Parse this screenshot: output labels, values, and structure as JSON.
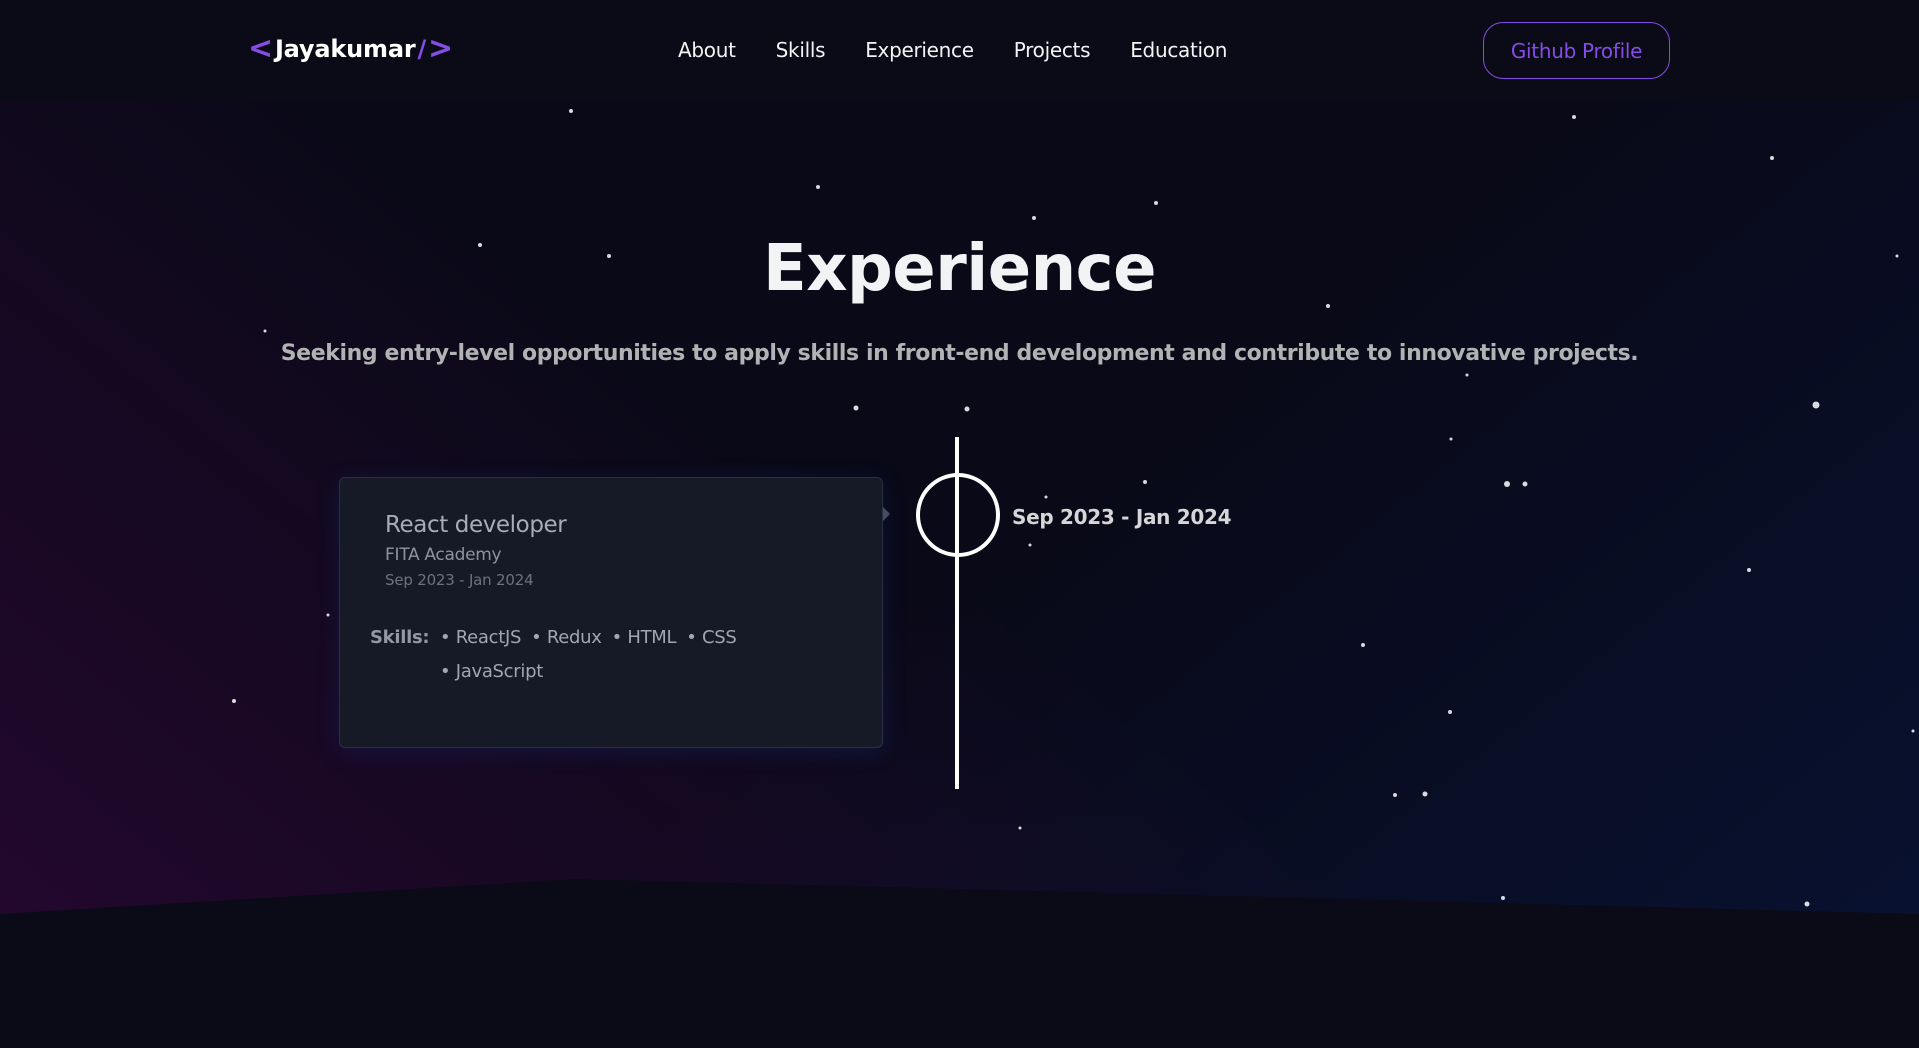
{
  "navbar": {
    "logo": {
      "left_chevron": "<",
      "name": "Jayakumar",
      "slash": "/",
      "right_chevron": ">"
    },
    "links": [
      "About",
      "Skills",
      "Experience",
      "Projects",
      "Education"
    ],
    "github_button": "Github Profile"
  },
  "section": {
    "title": "Experience",
    "subtitle": "Seeking entry-level opportunities to apply skills in front-end development and contribute to innovative projects."
  },
  "experience": [
    {
      "role": "React developer",
      "company": "FITA Academy",
      "dates": "Sep 2023 - Jan 2024",
      "timeline_date": "Sep 2023 - Jan 2024",
      "skills_label": "Skills:",
      "skills": [
        "• ReactJS",
        "• Redux",
        "• HTML",
        "• CSS",
        "• JavaScript"
      ]
    }
  ],
  "colors": {
    "accent": "#854ce6",
    "background": "#090917",
    "card": "#161a26"
  }
}
